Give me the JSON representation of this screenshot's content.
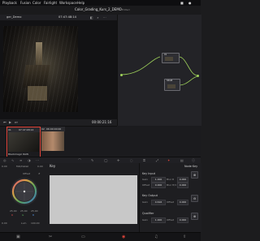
{
  "menubar": {
    "items": [
      "Playback",
      "Fusion",
      "Color",
      "Fairlight",
      "Workspace",
      "Help"
    ],
    "tray": {
      "battery": "■",
      "clock": "●"
    }
  },
  "titlebar": {
    "project_title": "Color_Grading_Kurs_2_DEMO",
    "status": "Edited"
  },
  "viewer": {
    "clip_name": "ger_Demo",
    "timecode_top": "07:47:48:14",
    "timecode": "00:00:21:16"
  },
  "nodes": [
    {
      "num": "01"
    },
    {
      "num": "SRGB"
    }
  ],
  "clips": [
    {
      "num": "01",
      "timecode": "07:47:48:14",
      "name": "Blackmagic RAW"
    },
    {
      "num": "02",
      "timecode": "06:00:00:00",
      "name": ""
    }
  ],
  "wheels": {
    "value_1": "0.00",
    "mode_label": "Mid/Detail",
    "value_2": "0.00",
    "wheel_title": "Offset",
    "readouts": [
      "25.00",
      "25.00",
      "25.00"
    ],
    "rgb": [
      "R",
      "G",
      "B"
    ],
    "bottom_labels": [
      "Lum",
      "100.00"
    ],
    "bottom_value": "0.00"
  },
  "key_panel": {
    "title": "Key"
  },
  "key_settings": {
    "title": "Node Key",
    "key_input": {
      "title": "Key Input",
      "rows": [
        {
          "label": "Gain",
          "value": "1.000",
          "right_label": "Blur R",
          "right_value": "0.000"
        },
        {
          "label": "Offset",
          "value": "0.000",
          "right_label": "Blur H/V",
          "right_value": "0.000"
        }
      ]
    },
    "key_output": {
      "title": "Key Output",
      "rows": [
        {
          "label": "Gain",
          "value": "0.616",
          "right_label": "Offset",
          "right_value": "0.000"
        }
      ]
    },
    "qualifier": {
      "title": "Qualifier",
      "rows": [
        {
          "label": "Gain",
          "value": "1.000",
          "right_label": "Offset",
          "right_value": "0.000"
        }
      ]
    }
  },
  "colors": {
    "accent": "#e3453a",
    "node_link": "#9fd25a",
    "input_port": "#4fa0e6"
  }
}
